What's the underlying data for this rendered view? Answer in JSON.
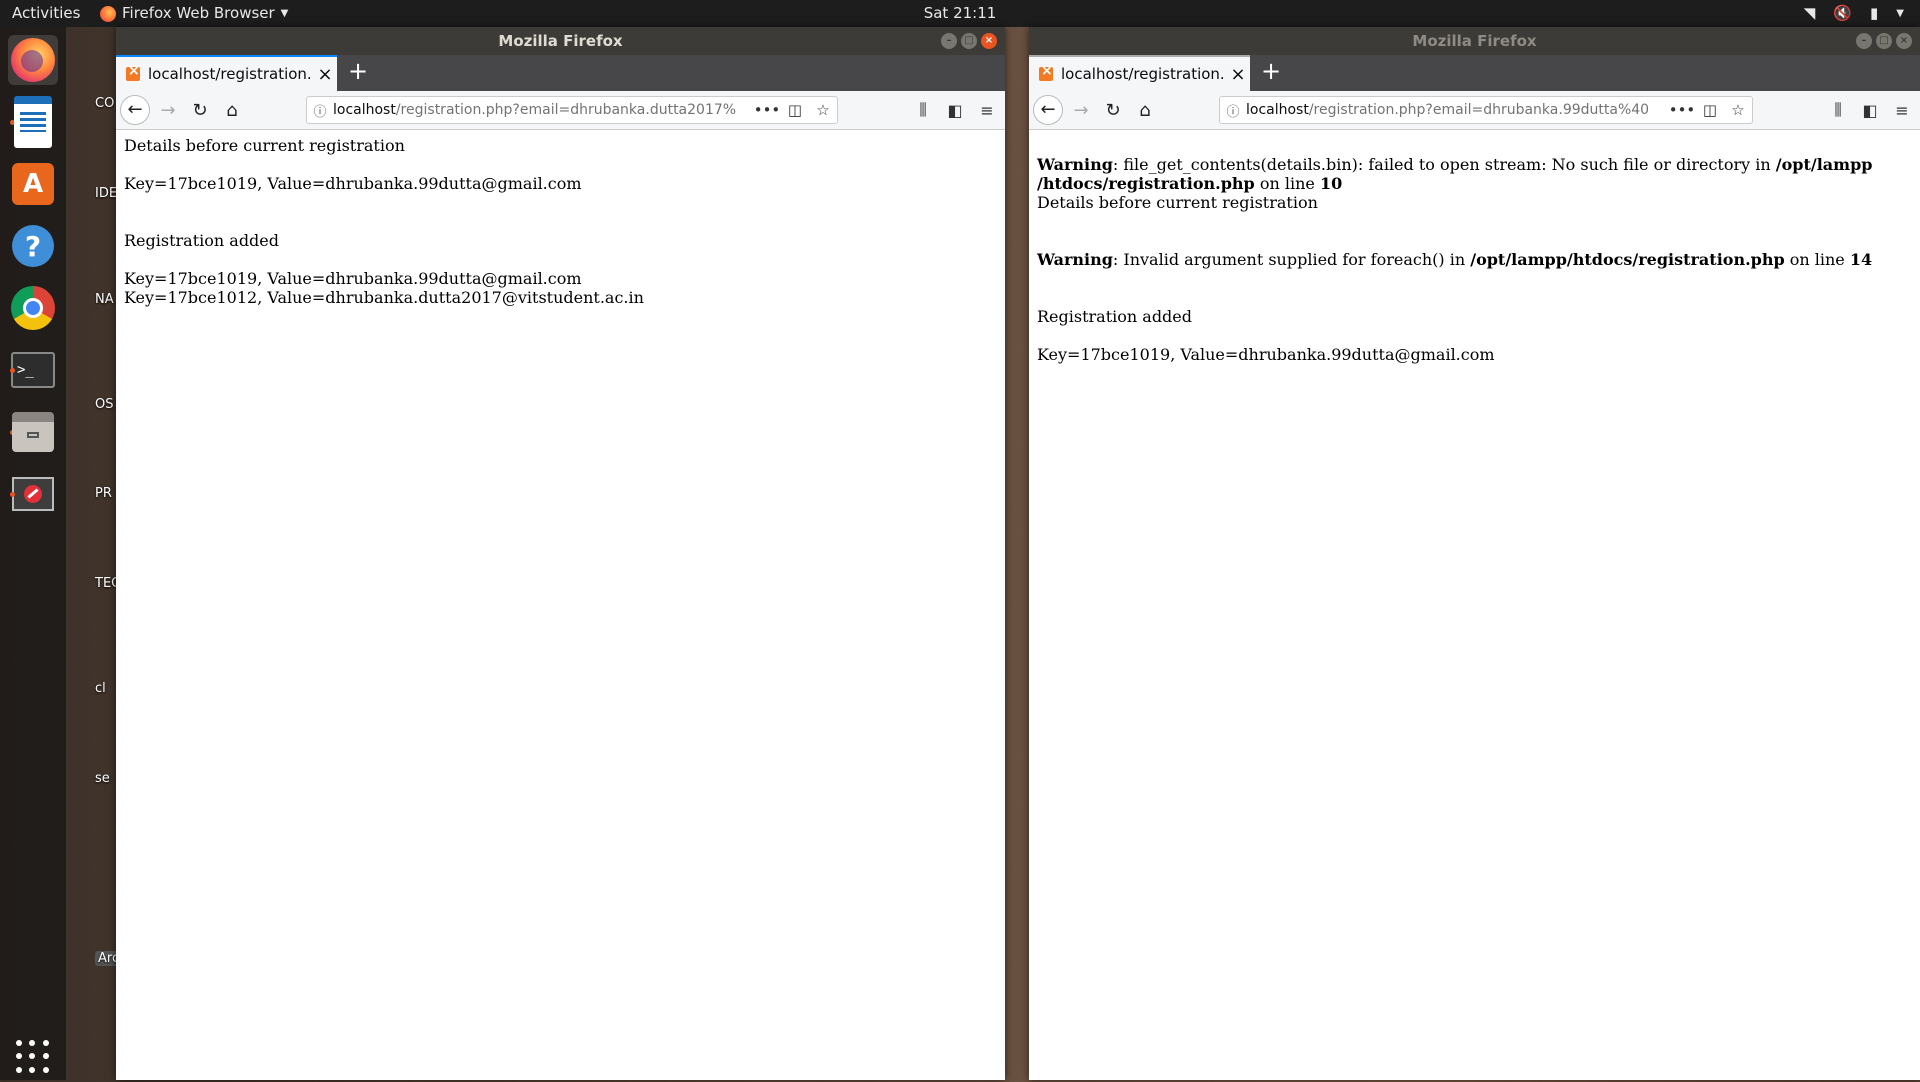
{
  "topbar": {
    "activities": "Activities",
    "app_name": "Firefox Web Browser",
    "clock": "Sat 21:11"
  },
  "dock": {
    "apps": [
      "firefox-icon",
      "libreoffice-writer-icon",
      "software-store-icon",
      "help-icon",
      "chrome-icon",
      "terminal-icon",
      "files-icon",
      "disc-icon",
      "show-apps-icon"
    ]
  },
  "desktop": {
    "labels": [
      "CO",
      "IDE",
      "NA",
      "OS",
      "PR",
      "TEC",
      "cl",
      "se",
      "Arc"
    ]
  },
  "left_window": {
    "title": "Mozilla Firefox",
    "tab_title": "localhost/registration.php",
    "url_host": "localhost",
    "url_path": "/registration.php?email=dhrubanka.dutta2017%",
    "content": {
      "line1": "Details before current registration",
      "line2": "Key=17bce1019, Value=dhrubanka.99dutta@gmail.com",
      "line3": "Registration added",
      "line4": "Key=17bce1019, Value=dhrubanka.99dutta@gmail.com",
      "line5": "Key=17bce1012, Value=dhrubanka.dutta2017@vitstudent.ac.in"
    }
  },
  "right_window": {
    "title": "Mozilla Firefox",
    "tab_title": "localhost/registration.php",
    "url_host": "localhost",
    "url_path": "/registration.php?email=dhrubanka.99dutta%40",
    "content": {
      "warn1_label": "Warning",
      "warn1_text": ": file_get_contents(details.bin): failed to open stream: No such file or directory in ",
      "warn1_path": "/opt/lampp /htdocs/registration.php",
      "warn1_online": " on line ",
      "warn1_line": "10",
      "line_details": "Details before current registration",
      "warn2_label": "Warning",
      "warn2_text": ": Invalid argument supplied for foreach() in ",
      "warn2_path": "/opt/lampp/htdocs/registration.php",
      "warn2_online": " on line ",
      "warn2_line": "14",
      "line_added": "Registration added",
      "line_kv": "Key=17bce1019, Value=dhrubanka.99dutta@gmail.com"
    }
  },
  "colors": {
    "accent_orange": "#e95420",
    "tab_blue": "#0a84ff",
    "titlebar": "#3c3b37"
  }
}
